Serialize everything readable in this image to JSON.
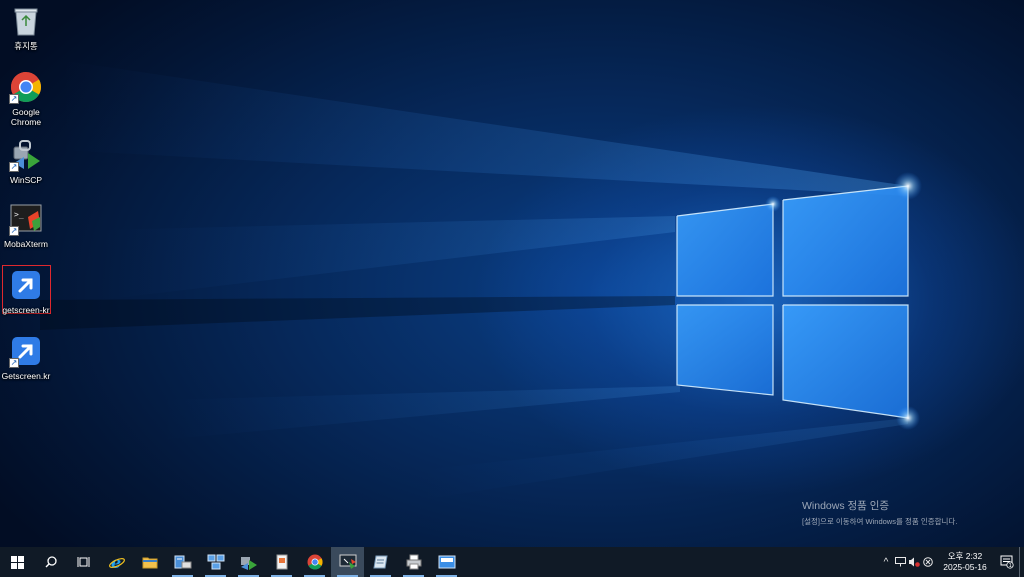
{
  "desktop": {
    "icons": [
      {
        "label": "휴지통",
        "icon": "recycle-bin-icon"
      },
      {
        "label": "Google Chrome",
        "icon": "chrome-icon"
      },
      {
        "label": "WinSCP",
        "icon": "winscp-icon"
      },
      {
        "label": "MobaXterm",
        "icon": "mobaxterm-icon"
      },
      {
        "label": "getscreen-kr",
        "icon": "getscreen-icon",
        "selected": true
      },
      {
        "label": "Getscreen.kr",
        "icon": "getscreen-icon"
      }
    ],
    "watermark": {
      "title": "Windows 정품 인증",
      "subtitle": "[설정]으로 이동하여 Windows를 정품 인증합니다."
    }
  },
  "taskbar": {
    "buttons": [
      {
        "name": "start-button",
        "icon": "windows-logo-icon"
      },
      {
        "name": "search-button",
        "icon": "search-icon"
      },
      {
        "name": "task-view-button",
        "icon": "task-view-icon"
      },
      {
        "name": "internet-explorer",
        "icon": "ie-icon"
      },
      {
        "name": "file-explorer",
        "icon": "folder-icon"
      },
      {
        "name": "server-manager",
        "icon": "server-manager-icon"
      },
      {
        "name": "network-app",
        "icon": "network-icon"
      },
      {
        "name": "winscp-app",
        "icon": "winscp-icon"
      },
      {
        "name": "document-app",
        "icon": "document-icon"
      },
      {
        "name": "chrome-app",
        "icon": "chrome-icon"
      },
      {
        "name": "remote-screen-app",
        "icon": "remote-desktop-icon"
      },
      {
        "name": "notepad-app",
        "icon": "notepad-icon"
      },
      {
        "name": "print-app",
        "icon": "printer-icon"
      },
      {
        "name": "mail-app",
        "icon": "mail-icon"
      }
    ],
    "tray": {
      "chevron": "^",
      "time": "오후 2:32",
      "date": "2025-05-16",
      "notification_count": "1"
    },
    "accent_color": "#7fb2e6"
  }
}
